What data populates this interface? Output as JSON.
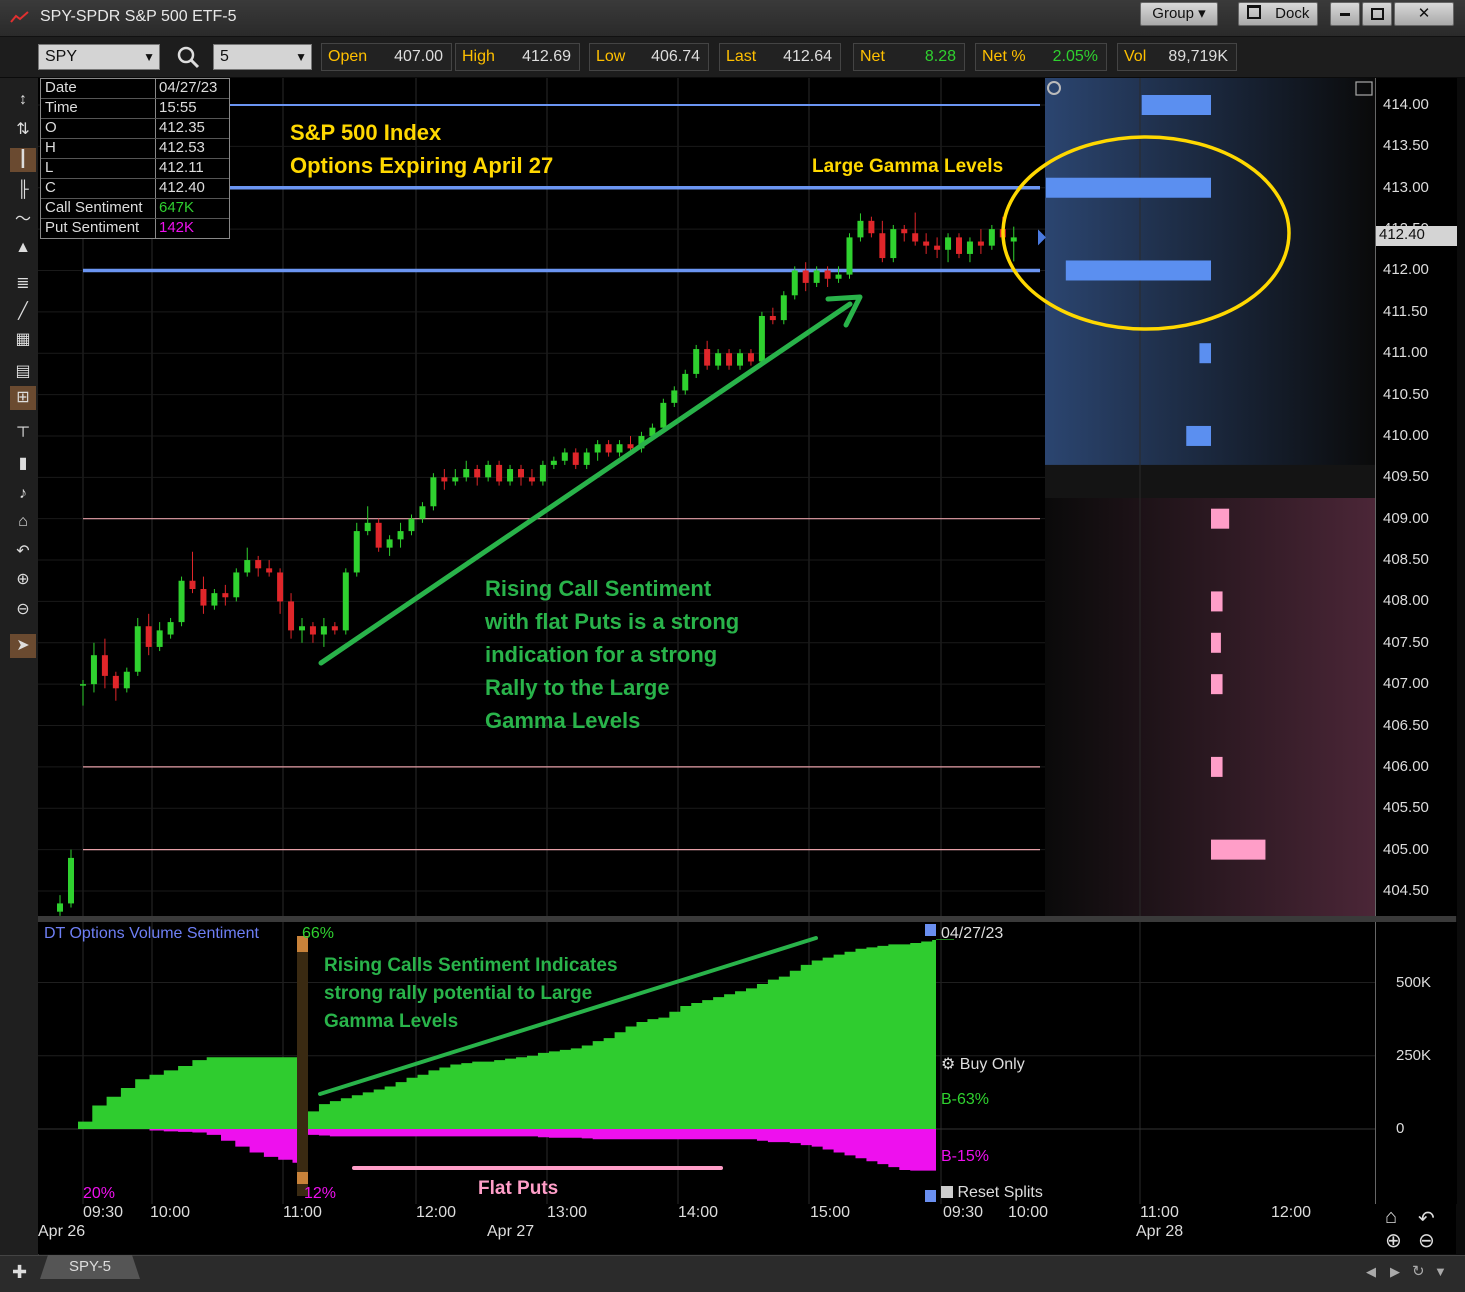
{
  "window": {
    "title": "SPY-SPDR S&P 500 ETF-5",
    "group_label": "Group",
    "dock_label": "Dock"
  },
  "quote": {
    "symbol": "SPY",
    "interval": "5",
    "fields": [
      {
        "label": "Open",
        "value": "407.00"
      },
      {
        "label": "High",
        "value": "412.69"
      },
      {
        "label": "Low",
        "value": "406.74"
      },
      {
        "label": "Last",
        "value": "412.64"
      },
      {
        "label": "Net",
        "value": "8.28"
      },
      {
        "label": "Net %",
        "value": "2.05%"
      },
      {
        "label": "Vol",
        "value": "89,719K"
      }
    ]
  },
  "databox": [
    {
      "k": "Date",
      "v": "04/27/23"
    },
    {
      "k": "Time",
      "v": "15:55"
    },
    {
      "k": "O",
      "v": "412.35"
    },
    {
      "k": "H",
      "v": "412.53"
    },
    {
      "k": "L",
      "v": "412.11"
    },
    {
      "k": "C",
      "v": "412.40"
    },
    {
      "k": "Call Sentiment",
      "v": "647K"
    },
    {
      "k": "Put Sentiment",
      "v": "142K"
    }
  ],
  "annotations": {
    "title_line1": "S&P 500 Index",
    "title_line2": "Options Expiring April 27",
    "gamma_label": "Large Gamma Levels",
    "rising_call": [
      "Rising Call Sentiment",
      "with flat Puts is a strong",
      "indication for a strong",
      "Rally to the Large",
      "Gamma Levels"
    ],
    "sub_note": [
      "Rising Calls Sentiment Indicates",
      "strong rally potential to Large",
      "Gamma Levels"
    ],
    "flat_puts": "Flat Puts"
  },
  "price_axis": [
    "414.00",
    "413.50",
    "413.00",
    "412.50",
    "412.00",
    "411.50",
    "411.00",
    "410.50",
    "410.00",
    "409.50",
    "409.00",
    "408.50",
    "408.00",
    "407.50",
    "407.00",
    "406.50",
    "406.00",
    "405.50",
    "405.00",
    "404.50"
  ],
  "last_price_tag": "412.40",
  "sub_axis": [
    "500K",
    "250K",
    "0"
  ],
  "sub_panel": {
    "title": "DT Options Volume Sentiment",
    "pct_top": "66%",
    "pct_bottom": "12%",
    "pct_left": "20%",
    "date_label": "04/27/23",
    "buy_only": "Buy Only",
    "b_call": "B-63%",
    "b_put": "B-15%",
    "reset": "Reset Splits"
  },
  "time_axis": {
    "ticks": [
      "09:30",
      "10:00",
      "11:00",
      "12:00",
      "13:00",
      "14:00",
      "15:00",
      "09:30",
      "10:00",
      "11:00",
      "12:00"
    ],
    "dates": [
      "Apr 26",
      "Apr 27",
      "Apr 28"
    ]
  },
  "tab_label": "SPY-5",
  "colors": {
    "up": "#2fd12f",
    "down": "#e0262a",
    "gamma_call": "#5b8ff0",
    "gamma_put": "#ff9ec8",
    "call_area": "#2fcc2f",
    "put_area": "#ee10ee",
    "anno_green": "#29b34a",
    "anno_yellow": "#ffd800"
  },
  "chart_data": [
    {
      "type": "candlestick",
      "title": "SPY-SPDR S&P 500 ETF-5",
      "interval_minutes": 5,
      "ylim": [
        404.25,
        414.3
      ],
      "gamma_levels_call": [
        {
          "price": 414.0,
          "size": 0.42
        },
        {
          "price": 413.0,
          "size": 1.0
        },
        {
          "price": 412.0,
          "size": 0.88
        },
        {
          "price": 411.0,
          "size": 0.07
        },
        {
          "price": 410.0,
          "size": 0.15
        }
      ],
      "gamma_levels_put": [
        {
          "price": 409.0,
          "size": 0.11
        },
        {
          "price": 408.0,
          "size": 0.07
        },
        {
          "price": 407.5,
          "size": 0.06
        },
        {
          "price": 407.0,
          "size": 0.07
        },
        {
          "price": 406.0,
          "size": 0.07
        },
        {
          "price": 405.0,
          "size": 0.33
        }
      ],
      "horizontal_lines": [
        414.0,
        413.0,
        412.0,
        409.0,
        406.0,
        405.0
      ],
      "candles": [
        [
          404.25,
          404.45,
          404.2,
          404.35
        ],
        [
          404.35,
          405.0,
          404.3,
          404.9
        ],
        [
          407.0,
          407.05,
          406.74,
          407.0
        ],
        [
          407.0,
          407.5,
          406.9,
          407.35
        ],
        [
          407.35,
          407.55,
          406.95,
          407.1
        ],
        [
          407.1,
          407.15,
          406.8,
          406.95
        ],
        [
          406.95,
          407.2,
          406.9,
          407.15
        ],
        [
          407.15,
          407.8,
          407.1,
          407.7
        ],
        [
          407.7,
          407.85,
          407.35,
          407.45
        ],
        [
          407.45,
          407.75,
          407.4,
          407.65
        ],
        [
          407.6,
          407.8,
          407.55,
          407.75
        ],
        [
          407.75,
          408.3,
          407.7,
          408.25
        ],
        [
          408.25,
          408.6,
          408.1,
          408.15
        ],
        [
          408.15,
          408.3,
          407.85,
          407.95
        ],
        [
          407.95,
          408.15,
          407.9,
          408.1
        ],
        [
          408.1,
          408.2,
          407.95,
          408.05
        ],
        [
          408.05,
          408.4,
          408.0,
          408.35
        ],
        [
          408.35,
          408.65,
          408.3,
          408.5
        ],
        [
          408.5,
          408.55,
          408.3,
          408.4
        ],
        [
          408.4,
          408.5,
          408.3,
          408.35
        ],
        [
          408.35,
          408.4,
          407.85,
          408.0
        ],
        [
          408.0,
          408.1,
          407.55,
          407.65
        ],
        [
          407.65,
          407.8,
          407.5,
          407.7
        ],
        [
          407.7,
          407.75,
          407.5,
          407.6
        ],
        [
          407.6,
          407.8,
          407.45,
          407.7
        ],
        [
          407.7,
          407.75,
          407.6,
          407.65
        ],
        [
          407.65,
          408.4,
          407.6,
          408.35
        ],
        [
          408.35,
          408.95,
          408.3,
          408.85
        ],
        [
          408.85,
          409.15,
          408.8,
          408.95
        ],
        [
          408.95,
          409.0,
          408.6,
          408.65
        ],
        [
          408.65,
          408.8,
          408.55,
          408.75
        ],
        [
          408.75,
          408.95,
          408.65,
          408.85
        ],
        [
          408.85,
          409.05,
          408.8,
          409.0
        ],
        [
          409.0,
          409.2,
          408.95,
          409.15
        ],
        [
          409.15,
          409.55,
          409.1,
          409.5
        ],
        [
          409.5,
          409.6,
          409.35,
          409.45
        ],
        [
          409.45,
          409.6,
          409.4,
          409.5
        ],
        [
          409.5,
          409.7,
          409.45,
          409.6
        ],
        [
          409.6,
          409.65,
          409.4,
          409.5
        ],
        [
          409.5,
          409.7,
          409.45,
          409.65
        ],
        [
          409.65,
          409.7,
          409.4,
          409.45
        ],
        [
          409.45,
          409.65,
          409.4,
          409.6
        ],
        [
          409.6,
          409.65,
          409.4,
          409.5
        ],
        [
          409.5,
          409.6,
          409.4,
          409.45
        ],
        [
          409.45,
          409.7,
          409.4,
          409.65
        ],
        [
          409.65,
          409.75,
          409.6,
          409.7
        ],
        [
          409.7,
          409.85,
          409.65,
          409.8
        ],
        [
          409.8,
          409.85,
          409.6,
          409.65
        ],
        [
          409.65,
          409.85,
          409.6,
          409.8
        ],
        [
          409.8,
          409.95,
          409.7,
          409.9
        ],
        [
          409.9,
          409.95,
          409.75,
          409.8
        ],
        [
          409.8,
          409.95,
          409.75,
          409.9
        ],
        [
          409.9,
          410.0,
          409.8,
          409.85
        ],
        [
          409.85,
          410.05,
          409.8,
          410.0
        ],
        [
          410.0,
          410.15,
          409.95,
          410.1
        ],
        [
          410.1,
          410.45,
          410.05,
          410.4
        ],
        [
          410.4,
          410.6,
          410.35,
          410.55
        ],
        [
          410.55,
          410.8,
          410.5,
          410.75
        ],
        [
          410.75,
          411.1,
          410.7,
          411.05
        ],
        [
          411.05,
          411.15,
          410.8,
          410.85
        ],
        [
          410.85,
          411.05,
          410.8,
          411.0
        ],
        [
          411.0,
          411.05,
          410.8,
          410.85
        ],
        [
          410.85,
          411.05,
          410.8,
          411.0
        ],
        [
          411.0,
          411.05,
          410.85,
          410.9
        ],
        [
          410.9,
          411.5,
          410.85,
          411.45
        ],
        [
          411.45,
          411.55,
          411.35,
          411.4
        ],
        [
          411.4,
          411.75,
          411.35,
          411.7
        ],
        [
          411.7,
          412.05,
          411.65,
          412.0
        ],
        [
          412.0,
          412.1,
          411.75,
          411.85
        ],
        [
          411.85,
          412.05,
          411.8,
          412.0
        ],
        [
          412.0,
          412.05,
          411.8,
          411.9
        ],
        [
          411.9,
          412.05,
          411.85,
          411.95
        ],
        [
          411.95,
          412.45,
          411.9,
          412.4
        ],
        [
          412.4,
          412.69,
          412.35,
          412.6
        ],
        [
          412.6,
          412.65,
          412.4,
          412.45
        ],
        [
          412.45,
          412.6,
          412.1,
          412.15
        ],
        [
          412.15,
          412.55,
          412.1,
          412.5
        ],
        [
          412.5,
          412.55,
          412.35,
          412.45
        ],
        [
          412.45,
          412.7,
          412.3,
          412.35
        ],
        [
          412.35,
          412.45,
          412.2,
          412.3
        ],
        [
          412.3,
          412.4,
          412.15,
          412.25
        ],
        [
          412.25,
          412.45,
          412.1,
          412.4
        ],
        [
          412.4,
          412.45,
          412.15,
          412.2
        ],
        [
          412.2,
          412.4,
          412.1,
          412.35
        ],
        [
          412.35,
          412.5,
          412.2,
          412.3
        ],
        [
          412.3,
          412.55,
          412.25,
          412.5
        ],
        [
          412.5,
          412.65,
          412.35,
          412.4
        ],
        [
          412.35,
          412.53,
          412.11,
          412.4
        ]
      ]
    },
    {
      "type": "area",
      "title": "DT Options Volume Sentiment",
      "unit": "K",
      "ylim": [
        -250,
        700
      ],
      "series": [
        {
          "name": "Call Sentiment",
          "values": [
            25,
            80,
            110,
            140,
            170,
            185,
            200,
            215,
            235,
            245,
            245,
            245,
            245,
            245,
            245,
            245,
            60,
            85,
            95,
            105,
            115,
            125,
            135,
            145,
            160,
            175,
            185,
            200,
            210,
            220,
            225,
            230,
            230,
            235,
            240,
            245,
            250,
            260,
            265,
            270,
            275,
            285,
            300,
            310,
            330,
            350,
            365,
            375,
            380,
            400,
            420,
            430,
            440,
            450,
            460,
            470,
            480,
            495,
            510,
            520,
            540,
            560,
            575,
            585,
            595,
            605,
            615,
            620,
            625,
            630,
            630,
            635,
            640,
            645,
            645,
            647
          ]
        },
        {
          "name": "Put Sentiment",
          "values": [
            0,
            0,
            0,
            0,
            0,
            -5,
            -8,
            -10,
            -12,
            -20,
            -40,
            -60,
            -80,
            -95,
            -105,
            -115,
            -20,
            -22,
            -25,
            -25,
            -25,
            -25,
            -25,
            -25,
            -25,
            -25,
            -25,
            -25,
            -25,
            -25,
            -25,
            -25,
            -25,
            -25,
            -25,
            -25,
            -25,
            -28,
            -30,
            -30,
            -30,
            -32,
            -35,
            -35,
            -35,
            -35,
            -35,
            -35,
            -35,
            -35,
            -35,
            -35,
            -35,
            -35,
            -35,
            -35,
            -35,
            -40,
            -45,
            -45,
            -48,
            -55,
            -60,
            -70,
            -80,
            -90,
            -100,
            -110,
            -120,
            -130,
            -140,
            -142,
            -142,
            -142,
            -142,
            -142
          ]
        }
      ]
    }
  ]
}
